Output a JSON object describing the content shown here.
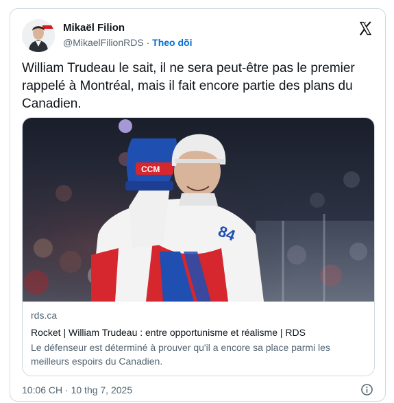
{
  "author": {
    "name": "Mikaël Filion",
    "handle": "@MikaelFilionRDS",
    "separator": "·",
    "follow_label": "Theo dõi"
  },
  "tweet": {
    "text": "William Trudeau le sait, il ne sera peut-être pas le premier rappelé à Montréal, mais il fait encore partie des plans du Canadien."
  },
  "link_card": {
    "domain": "rds.ca",
    "title": "Rocket | William Trudeau : entre opportunisme et réalisme | RDS",
    "description": "Le défenseur est déterminé à prouver qu'il a encore sa place parmi les meilleurs espoirs du Canadien.",
    "jersey_number": "84"
  },
  "footer": {
    "timestamp": "10:06 CH · 10 thg 7, 2025"
  },
  "icons": {
    "x_logo": "x-logo-icon",
    "info": "info-icon"
  },
  "colors": {
    "follow": "#006fd6",
    "secondary_text": "#536471",
    "border": "#cfd9de"
  }
}
